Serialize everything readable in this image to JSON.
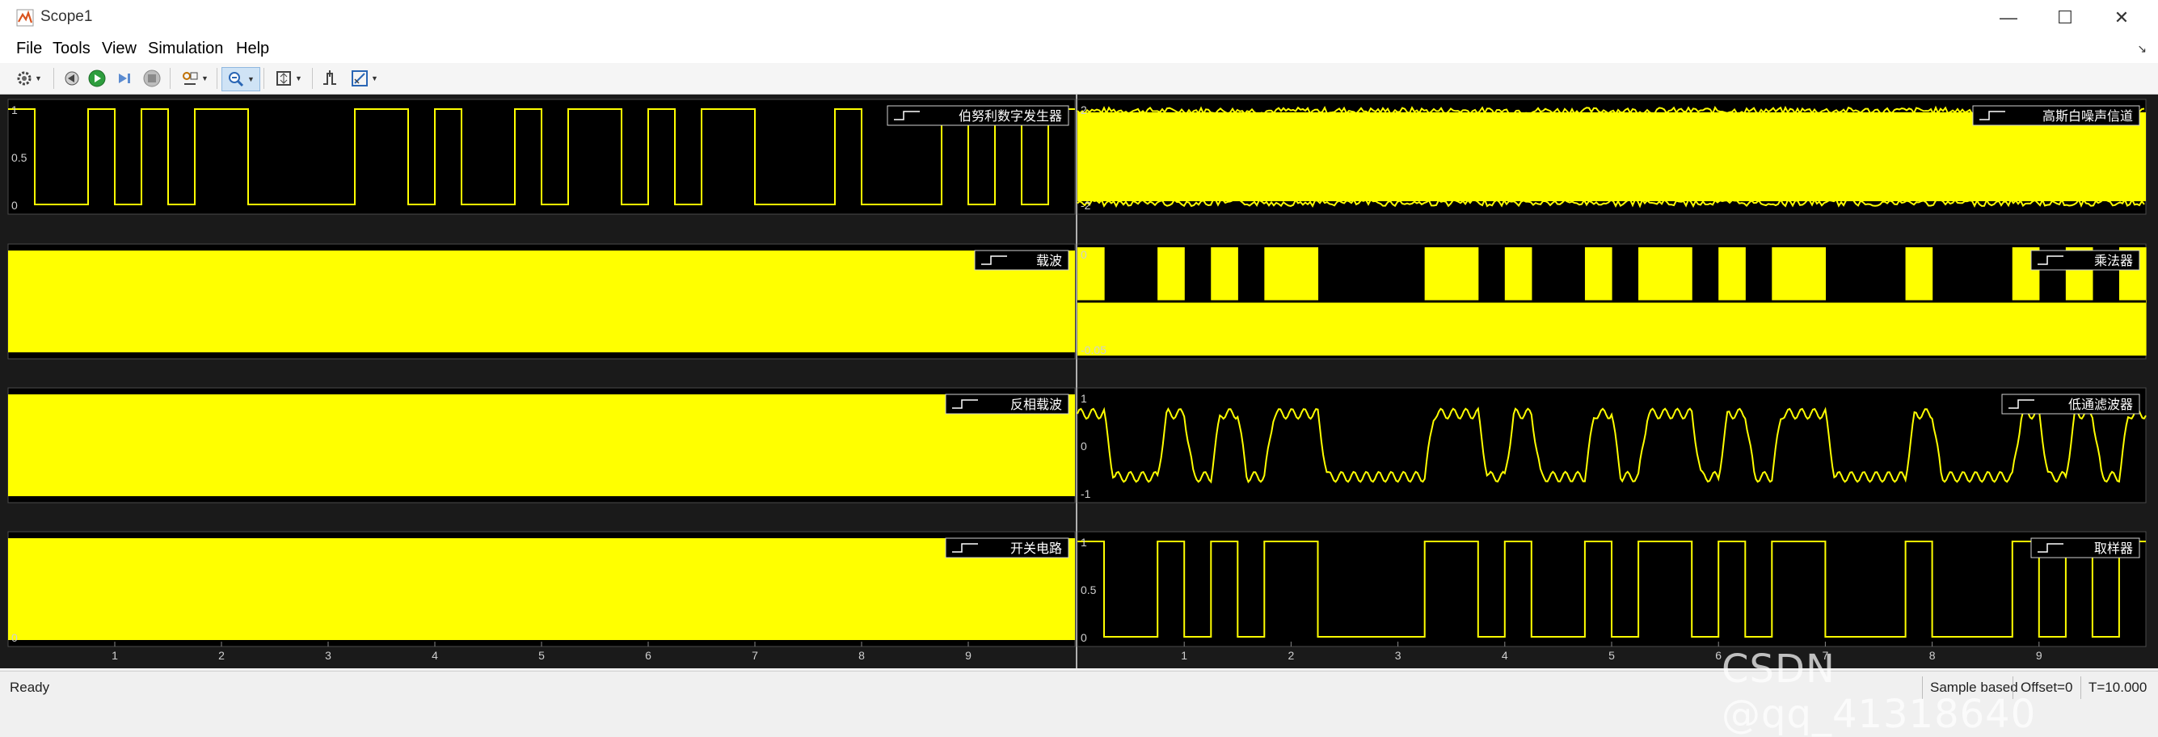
{
  "window": {
    "title": "Scope1",
    "minimize_glyph": "—",
    "maximize_glyph": "☐",
    "close_glyph": "✕"
  },
  "menu": {
    "items": [
      "File",
      "Tools",
      "View",
      "Simulation",
      "Help"
    ]
  },
  "toolbar": {
    "icons": [
      "settings-icon",
      "step-back-icon",
      "run-icon",
      "step-forward-icon",
      "stop-icon",
      "highlight-icon",
      "zoom-icon",
      "fit-to-view-icon",
      "triggers-icon",
      "measurements-icon"
    ]
  },
  "plots": [
    {
      "id": "bernoulli",
      "legend": "伯努利数字发生器",
      "y_ticks": [
        "1",
        "0.5",
        "0"
      ],
      "style": "square"
    },
    {
      "id": "awgn",
      "legend": "高斯白噪声信道",
      "y_ticks": [
        "2",
        "-2"
      ],
      "style": "noise"
    },
    {
      "id": "carrier",
      "legend": "载波",
      "y_ticks": [],
      "style": "solid"
    },
    {
      "id": "multiplier",
      "legend": "乘法器",
      "y_ticks": [
        "0",
        "-0.05"
      ],
      "style": "mixed"
    },
    {
      "id": "inverted_carrier",
      "legend": "反相载波",
      "y_ticks": [],
      "style": "solid"
    },
    {
      "id": "lowpass",
      "legend": "低通滤波器",
      "y_ticks": [
        "1",
        "0",
        "-1"
      ],
      "style": "filtered"
    },
    {
      "id": "switch",
      "legend": "开关电路",
      "y_ticks": [
        "0"
      ],
      "style": "solid"
    },
    {
      "id": "sampler",
      "legend": "取样器",
      "y_ticks": [
        "1",
        "0.5",
        "0"
      ],
      "style": "square"
    }
  ],
  "x_ticks": [
    "1",
    "2",
    "3",
    "4",
    "5",
    "6",
    "7",
    "8",
    "9"
  ],
  "bit_sequence": [
    1,
    0,
    0,
    1,
    0,
    1,
    0,
    1,
    1,
    0,
    0,
    0,
    0,
    1,
    1,
    0,
    1,
    0,
    0,
    1,
    0,
    1,
    1,
    0,
    1,
    0,
    1,
    1,
    0,
    0,
    0,
    1,
    0,
    0,
    0,
    1,
    0,
    1,
    0,
    1
  ],
  "status": {
    "state": "Ready",
    "sample_mode": "Sample based",
    "offset": "Offset=0",
    "time": "T=10.000"
  },
  "watermark": "CSDN @qq_41318640",
  "colors": {
    "trace": "#ffff00",
    "background": "#000000",
    "axes": "#4a4a4a",
    "tick_text": "#cfcfcf"
  }
}
